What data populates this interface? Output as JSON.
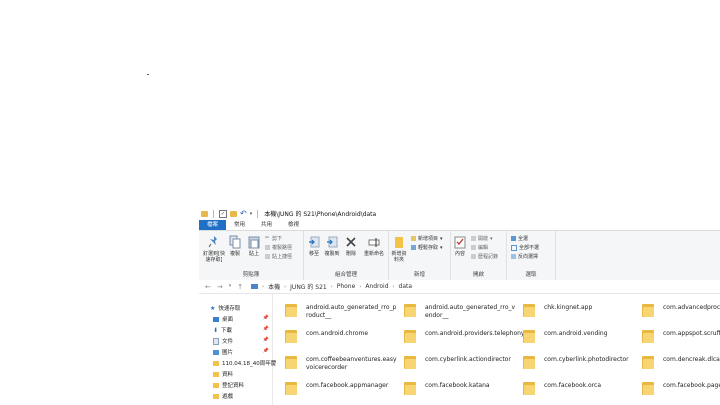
{
  "window": {
    "title": "本機\\JUNG 的 S21\\Phone\\Android\\data"
  },
  "tabs": [
    "檔案",
    "常用",
    "共用",
    "檢視"
  ],
  "ribbon": {
    "clipboard": {
      "label": "剪貼簿",
      "pin_label": "釘選到[快速存取]",
      "copy_label": "複製",
      "paste_label": "貼上",
      "cut_label": "剪下",
      "copy_path_label": "複製路徑",
      "paste_shortcut_label": "貼上捷徑"
    },
    "organize": {
      "label": "組合管理",
      "move_label": "移至",
      "copy_to_label": "複製到",
      "delete_label": "刪除",
      "rename_label": "重新命名"
    },
    "new": {
      "label": "新增",
      "new_folder_label": "新增資料夾",
      "new_item_label": "新增項目",
      "easy_access_label": "輕鬆存取"
    },
    "open": {
      "label": "開啟",
      "properties_label": "內容",
      "open_label": "開啟",
      "edit_label": "編輯",
      "history_label": "歷程記錄"
    },
    "select": {
      "label": "選取",
      "select_all_label": "全選",
      "select_none_label": "全部不選",
      "invert_label": "反向選擇"
    }
  },
  "address": {
    "crumbs": [
      "本機",
      "JUNG 的 S21",
      "Phone",
      "Android",
      "data"
    ]
  },
  "sidebar": {
    "items": [
      {
        "label": "快速存取",
        "pinned": false
      },
      {
        "label": "桌面",
        "pinned": true
      },
      {
        "label": "下載",
        "pinned": true
      },
      {
        "label": "文件",
        "pinned": true
      },
      {
        "label": "圖片",
        "pinned": true
      },
      {
        "label": "110.04.18_40周年慶",
        "pinned": false
      },
      {
        "label": "資料",
        "pinned": false
      },
      {
        "label": "登記資料",
        "pinned": false
      },
      {
        "label": "遊戲",
        "pinned": false
      }
    ]
  },
  "folders": [
    "android.auto_generated_rro_product__",
    "android.auto_generated_rro_vendor__",
    "chk.kingnet.app",
    "com.advancedprocess",
    "com.android.chrome",
    "com.android.providers.telephony",
    "com.android.vending",
    "com.appspot.scruffapp",
    "com.coffeebeanventures.easyvoicerecorder",
    "com.cyberlink.actiondirector",
    "com.cyberlink.photodirector",
    "com.dencreak.dlcalculator",
    "com.facebook.appmanager",
    "com.facebook.katana",
    "com.facebook.orca",
    "com.facebook.pages.app"
  ],
  "colors": {
    "accent": "#1f6fc4",
    "folder": "#f7d573"
  }
}
